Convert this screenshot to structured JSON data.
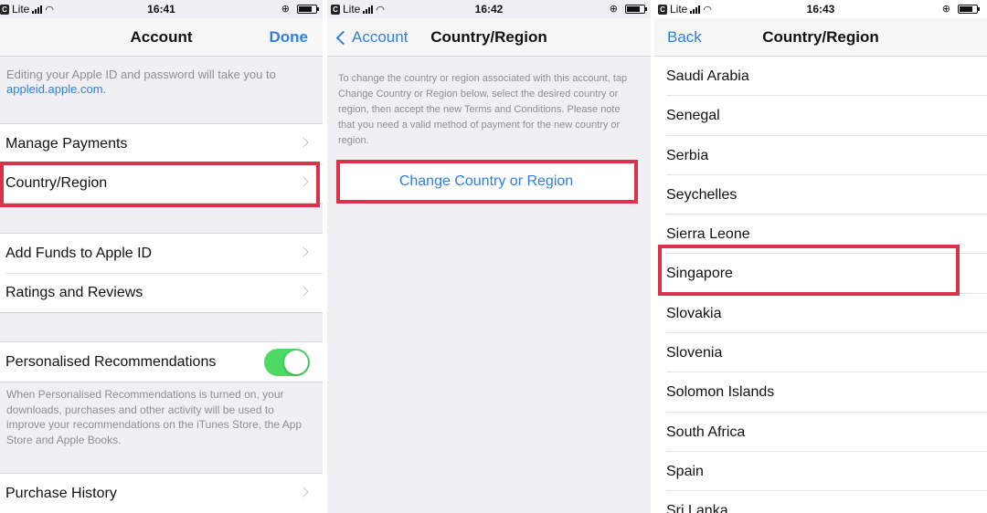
{
  "panel1": {
    "status": {
      "carrier": "Lite",
      "time": "16:41"
    },
    "nav": {
      "title": "Account",
      "done": "Done"
    },
    "intro_text": "Editing your Apple ID and password will take you to",
    "intro_link": "appleid.apple.com.",
    "group1": [
      "Manage Payments",
      "Country/Region"
    ],
    "group2": [
      "Add Funds to Apple ID",
      "Ratings and Reviews"
    ],
    "personalised": {
      "label": "Personalised Recommendations",
      "enabled": true,
      "note": "When Personalised Recommendations is turned on, your downloads, purchases and other activity will be used to improve your recommendations on the iTunes Store, the App Store and Apple Books."
    },
    "purchase_history": "Purchase History"
  },
  "panel2": {
    "status": {
      "carrier": "Lite",
      "time": "16:42"
    },
    "nav": {
      "back": "Account",
      "title": "Country/Region"
    },
    "note": "To change the country or region associated with this account, tap Change Country or Region below, select the desired country or region, then accept the new Terms and Conditions. Please note that you need a valid method of payment for the new country or region.",
    "button": "Change Country or Region"
  },
  "panel3": {
    "status": {
      "carrier": "Lite",
      "time": "16:43"
    },
    "nav": {
      "back": "Back",
      "title": "Country/Region"
    },
    "countries": [
      "Saudi Arabia",
      "Senegal",
      "Serbia",
      "Seychelles",
      "Sierra Leone",
      "Singapore",
      "Slovakia",
      "Slovenia",
      "Solomon Islands",
      "South Africa",
      "Spain",
      "Sri Lanka"
    ]
  },
  "colors": {
    "accent": "#2f7fe0",
    "highlight": "#d9324a",
    "toggle_on": "#4cd964"
  },
  "icons": [
    "signal-bars-icon",
    "wifi-icon",
    "battery-icon",
    "chevron-right-icon",
    "chevron-left-icon"
  ]
}
